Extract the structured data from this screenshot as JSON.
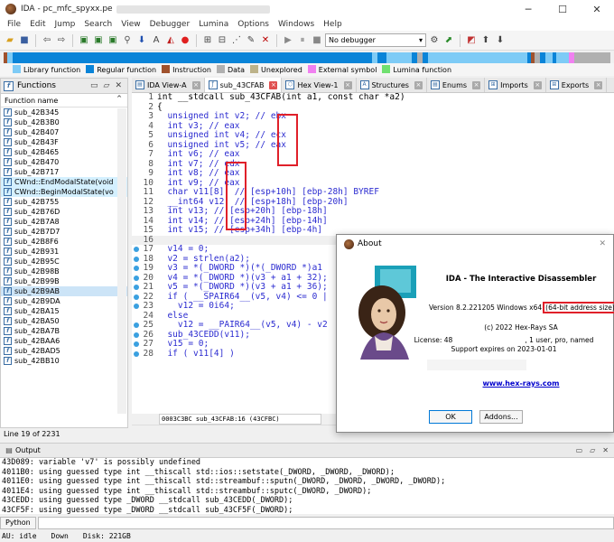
{
  "window": {
    "title": "IDA - pc_mfc_spyxx.pe"
  },
  "menu": [
    "File",
    "Edit",
    "Jump",
    "Search",
    "View",
    "Debugger",
    "Lumina",
    "Options",
    "Windows",
    "Help"
  ],
  "toolbar": {
    "debugger_select": "No debugger"
  },
  "legend": [
    {
      "label": "Library function",
      "color": "#7ecbf6"
    },
    {
      "label": "Regular function",
      "color": "#0a84d8"
    },
    {
      "label": "Instruction",
      "color": "#a0522d"
    },
    {
      "label": "Data",
      "color": "#b0b0b0"
    },
    {
      "label": "Unexplored",
      "color": "#bdb38a"
    },
    {
      "label": "External symbol",
      "color": "#f080f0"
    },
    {
      "label": "Lumina function",
      "color": "#70e070"
    }
  ],
  "functions": {
    "title": "Functions",
    "column": "Function name",
    "items": [
      {
        "name": "sub_42B345",
        "kind": "normal"
      },
      {
        "name": "sub_42B3B0",
        "kind": "normal"
      },
      {
        "name": "sub_42B407",
        "kind": "normal"
      },
      {
        "name": "sub_42B43F",
        "kind": "normal"
      },
      {
        "name": "sub_42B465",
        "kind": "normal"
      },
      {
        "name": "sub_42B470",
        "kind": "normal"
      },
      {
        "name": "sub_42B717",
        "kind": "normal"
      },
      {
        "name": "CWnd::EndModalState(void",
        "kind": "lib"
      },
      {
        "name": "CWnd::BeginModalState(vo",
        "kind": "lib"
      },
      {
        "name": "sub_42B755",
        "kind": "normal"
      },
      {
        "name": "sub_42B76D",
        "kind": "normal"
      },
      {
        "name": "sub_42B7A8",
        "kind": "normal"
      },
      {
        "name": "sub_42B7D7",
        "kind": "normal"
      },
      {
        "name": "sub_42B8F6",
        "kind": "normal"
      },
      {
        "name": "sub_42B931",
        "kind": "normal"
      },
      {
        "name": "sub_42B95C",
        "kind": "normal"
      },
      {
        "name": "sub_42B98B",
        "kind": "normal"
      },
      {
        "name": "sub_42B99B",
        "kind": "normal"
      },
      {
        "name": "sub_42B9AB",
        "kind": "selected"
      },
      {
        "name": "sub_42B9DA",
        "kind": "normal"
      },
      {
        "name": "sub_42BA15",
        "kind": "normal"
      },
      {
        "name": "sub_42BA50",
        "kind": "normal"
      },
      {
        "name": "sub_42BA7B",
        "kind": "normal"
      },
      {
        "name": "sub_42BAA6",
        "kind": "normal"
      },
      {
        "name": "sub_42BAD5",
        "kind": "normal"
      },
      {
        "name": "sub_42BB10",
        "kind": "normal"
      }
    ],
    "status": "Line 19 of 2231"
  },
  "tabs": [
    {
      "label": "IDA View-A",
      "active": false
    },
    {
      "label": "sub_43CFAB",
      "active": true
    },
    {
      "label": "Hex View-1",
      "active": false
    },
    {
      "label": "Structures",
      "active": false
    },
    {
      "label": "Enums",
      "active": false
    },
    {
      "label": "Imports",
      "active": false
    },
    {
      "label": "Exports",
      "active": false
    }
  ],
  "code": {
    "lines": [
      {
        "n": "1",
        "t": "int __stdcall sub_43CFAB(int a1, const char *a2)",
        "dot": false,
        "plain": true
      },
      {
        "n": "2",
        "t": "{",
        "dot": false,
        "plain": true
      },
      {
        "n": "3",
        "t": "  unsigned int v2; // ebx",
        "dot": false
      },
      {
        "n": "4",
        "t": "  int v3; // eax",
        "dot": false
      },
      {
        "n": "5",
        "t": "  unsigned int v4; // ecx",
        "dot": false
      },
      {
        "n": "6",
        "t": "  unsigned int v5; // eax",
        "dot": false
      },
      {
        "n": "7",
        "t": "  int v6; // eax",
        "dot": false
      },
      {
        "n": "8",
        "t": "  int v7; // edx",
        "dot": false
      },
      {
        "n": "9",
        "t": "  int v8; // eax",
        "dot": false
      },
      {
        "n": "10",
        "t": "  int v9; // eax",
        "dot": false
      },
      {
        "n": "11",
        "t": "  char v11[8]; // [esp+10h] [ebp-28h] BYREF",
        "dot": false
      },
      {
        "n": "12",
        "t": "  __int64 v12; // [esp+18h] [ebp-20h]",
        "dot": false
      },
      {
        "n": "13",
        "t": "  int v13; // [esp+20h] [ebp-18h]",
        "dot": false
      },
      {
        "n": "14",
        "t": "  int v14; // [esp+24h] [ebp-14h]",
        "dot": false
      },
      {
        "n": "15",
        "t": "  int v15; // [esp+34h] [ebp-4h]",
        "dot": false
      },
      {
        "n": "16",
        "t": "",
        "dot": false,
        "hl": true
      },
      {
        "n": "17",
        "t": "  v14 = 0;",
        "dot": true
      },
      {
        "n": "18",
        "t": "  v2 = strlen(a2);",
        "dot": true
      },
      {
        "n": "19",
        "t": "  v3 = *(_DWORD *)(*(_DWORD *)a1",
        "dot": true
      },
      {
        "n": "20",
        "t": "  v4 = *(_DWORD *)(v3 + a1 + 32);",
        "dot": true
      },
      {
        "n": "21",
        "t": "  v5 = *(_DWORD *)(v3 + a1 + 36);",
        "dot": true
      },
      {
        "n": "22",
        "t": "  if ( __SPAIR64__(v5, v4) <= 0 |",
        "dot": true
      },
      {
        "n": "23",
        "t": "    v12 = 0i64;",
        "dot": true
      },
      {
        "n": "24",
        "t": "  else",
        "dot": false
      },
      {
        "n": "25",
        "t": "    v12 = __PAIR64__(v5, v4) - v2",
        "dot": true
      },
      {
        "n": "26",
        "t": "  sub_43CEDD(v11);",
        "dot": true
      },
      {
        "n": "27",
        "t": "  v15 = 0;",
        "dot": true
      },
      {
        "n": "28",
        "t": "  if ( v11[4] )",
        "dot": true
      }
    ],
    "status": "0003C3BC sub_43CFAB:16 (43CFBC)"
  },
  "about": {
    "title": "About",
    "product": "IDA - The Interactive Disassembler",
    "version": "Version 8.2.221205 Windows x64",
    "address": "(64-bit address size)",
    "copyright": "(c) 2022 Hex-Rays SA",
    "license_label": "License:",
    "license_value": "48",
    "license_rest": ", 1 user, pro, named",
    "support": "Support expires on 2023-01-01",
    "link": "www.hex-rays.com",
    "ok": "OK",
    "addons": "Addons..."
  },
  "output": {
    "title": "Output",
    "lines": [
      "43D089: variable 'v7' is possibly undefined",
      "4011B0: using guessed type int __thiscall std::ios::setstate(_DWORD, _DWORD, _DWORD);",
      "4011E0: using guessed type int __thiscall std::streambuf::sputn(_DWORD, _DWORD, _DWORD, _DWORD);",
      "4011E4: using guessed type int __thiscall std::streambuf::sputc(_DWORD, _DWORD);",
      "43CEDD: using guessed type _DWORD __stdcall sub_43CEDD(_DWORD);",
      "43CF5F: using guessed type _DWORD __stdcall sub_43CF5F(_DWORD);"
    ],
    "python_tab": "Python"
  },
  "statusbar": {
    "au": "AU:",
    "state": "idle",
    "dir": "Down",
    "disk": "Disk: 221GB"
  }
}
